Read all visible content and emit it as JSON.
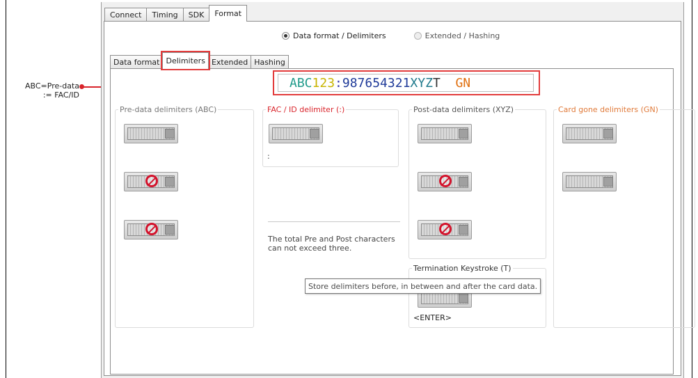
{
  "annotation": {
    "line1": "ABC=Pre-data",
    "line2": ":= FAC/ID"
  },
  "main_tabs": [
    "Connect",
    "Timing",
    "SDK",
    "Format"
  ],
  "active_main_tab": "Format",
  "radios": [
    {
      "label": "Data format / Delimiters",
      "checked": true
    },
    {
      "label": "Extended / Hashing",
      "checked": false
    }
  ],
  "sub_tabs": [
    "Data format",
    "Delimiters",
    "Extended",
    "Hashing"
  ],
  "active_sub_tab": "Delimiters",
  "format_preview": {
    "segments": [
      {
        "text": "ABC",
        "color": "#1f9a8a"
      },
      {
        "text": "123",
        "color": "#c8b400"
      },
      {
        "text": ":",
        "color": "#3b3bb0"
      },
      {
        "text": "987654321",
        "color": "#1f3a99"
      },
      {
        "text": "XYZ",
        "color": "#1f7a8c"
      },
      {
        "text": "T",
        "color": "#333333"
      },
      {
        "text": "  GN",
        "color": "#e07010"
      }
    ]
  },
  "groups": {
    "pre_data": {
      "title": "Pre-data delimiters (ABC)",
      "color": "#777777"
    },
    "fac_id": {
      "title": "FAC / ID delimiter (:)",
      "color": "#d9242b",
      "value": ":"
    },
    "post_data": {
      "title": "Post-data delimiters (XYZ)",
      "color": "#555555"
    },
    "card_gone": {
      "title": "Card gone delimiters (GN)",
      "color": "#e07a3a"
    },
    "termination": {
      "title": "Termination Keystroke (T)",
      "color": "#333333",
      "value": "<ENTER>"
    }
  },
  "note": {
    "line1": "The total Pre and Post characters",
    "line2": "can not exceed three."
  },
  "tooltip": "Store delimiters before, in between and after the card data.",
  "icons": {
    "keyboard": "keyboard-icon",
    "keyboard_disabled": "keyboard-disabled-icon"
  }
}
